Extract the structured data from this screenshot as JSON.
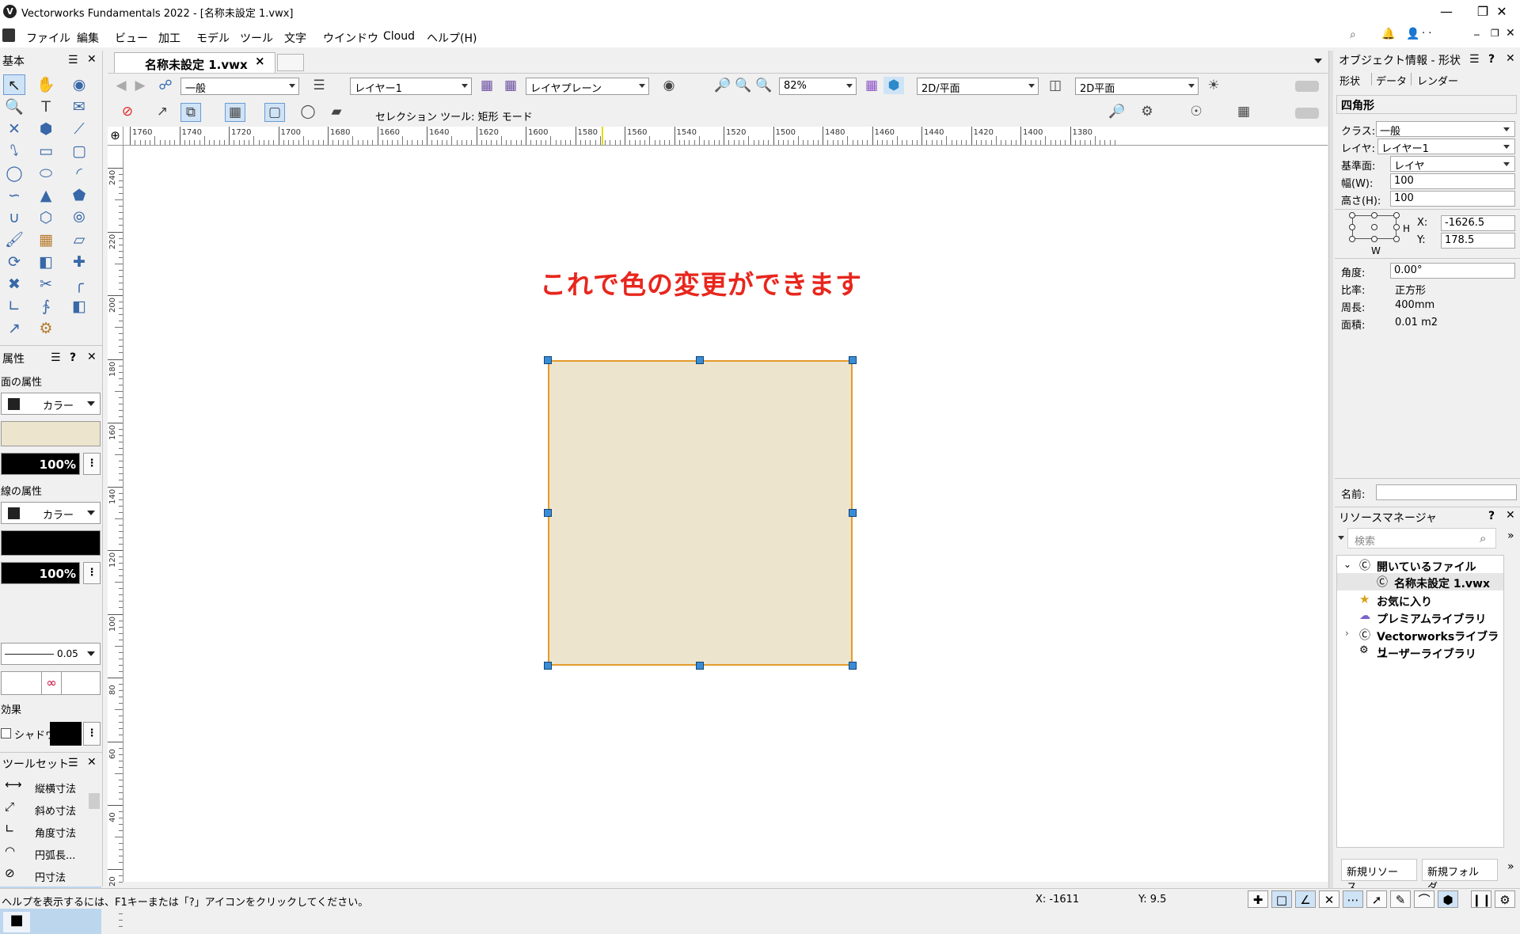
{
  "window": {
    "title": "Vectorworks Fundamentals 2022 - [名称未設定 1.vwx]",
    "app_icon": "vectorworks-logo-icon"
  },
  "menubar": {
    "items": [
      "ファイル",
      "編集",
      "ビュー",
      "加工",
      "モデル",
      "ツール",
      "文字",
      "ウインドウ",
      "Cloud",
      "ヘルプ(H)"
    ]
  },
  "document_tab": {
    "label": "名称未設定 1.vwx",
    "close": "×"
  },
  "view_bar": {
    "class_value": "一般",
    "layer_value": "レイヤー1",
    "plane_value": "レイヤプレーン",
    "zoom_value": "82%",
    "view_mode_value": "2D/平面",
    "render_value": "2D平面"
  },
  "tool_bar": {
    "mode_text": "セレクション ツール: 矩形 モード"
  },
  "palettes": {
    "basic_title": "基本",
    "attributes_title": "属性",
    "fill_section": "面の属性",
    "fill_type": "カラー",
    "fill_opacity": "100%",
    "fill_color": "#ece4cc",
    "line_section": "線の属性",
    "line_type": "カラー",
    "line_opacity": "100%",
    "line_color": "#000000",
    "line_weight": "0.05",
    "effects_section": "効果",
    "shadow_label": "シャドウ",
    "toolset_title": "ツールセット",
    "toolset_items": [
      "縦横寸法",
      "斜め寸法",
      "角度寸法",
      "円弧長...",
      "円寸法"
    ]
  },
  "ruler": {
    "top_labels": [
      "1760",
      "1740",
      "1720",
      "1700",
      "1680",
      "1660",
      "1640",
      "1620",
      "1600",
      "1580",
      "1560",
      "1540",
      "1520",
      "1500",
      "1480",
      "1460",
      "1440",
      "1420",
      "1400",
      "1380"
    ],
    "left_labels": [
      "240",
      "220",
      "200",
      "180",
      "160",
      "140",
      "120",
      "100",
      "80",
      "60",
      "40",
      "20"
    ]
  },
  "canvas": {
    "annotation": "これで色の変更ができます",
    "annotation_color": "#e8261d",
    "shape_fill": "#ece4cc",
    "shape_stroke": "#e59a2c"
  },
  "obj_info": {
    "title": "オブジェクト情報 - 形状",
    "tabs": [
      "形状",
      "データ",
      "レンダー"
    ],
    "shape_type": "四角形",
    "class_label": "クラス:",
    "class_value": "一般",
    "layer_label": "レイヤ:",
    "layer_value": "レイヤー1",
    "plane_label": "基準面:",
    "plane_value": "レイヤ",
    "width_label": "幅(W):",
    "width_value": "100",
    "height_label": "高さ(H):",
    "height_value": "100",
    "x_label": "X:",
    "x_value": "-1626.5",
    "y_label": "Y:",
    "y_value": "178.5",
    "w_mark": "W",
    "h_mark": "H",
    "angle_label": "角度:",
    "angle_value": "0.00°",
    "ratio_label": "比率:",
    "ratio_value": "正方形",
    "perimeter_label": "周長:",
    "perimeter_value": "400mm",
    "area_label": "面積:",
    "area_value": "0.01  m2",
    "name_label": "名前:"
  },
  "resource_manager": {
    "title": "リソースマネージャ",
    "search_placeholder": "検索",
    "tree": [
      "開いているファイル",
      "名称未設定 1.vwx",
      "お気に入り",
      "プレミアムライブラリ",
      "Vectorworksライブラリ",
      "ユーザーライブラリ"
    ],
    "new_resource_button": "新規リソース...",
    "new_folder_button": "新規フォルダ..."
  },
  "status": {
    "help_text": "ヘルプを表示するには、F1キーまたは「?」アイコンをクリックしてください。",
    "x_readout": "X: -1611",
    "y_readout": "Y: 9.5"
  }
}
